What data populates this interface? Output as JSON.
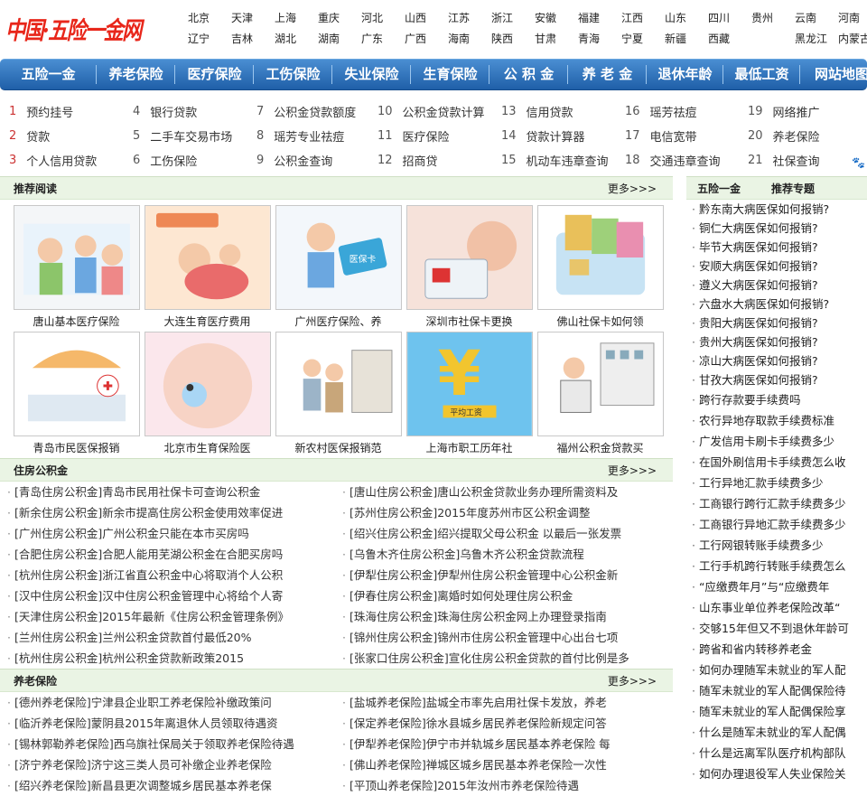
{
  "logo": {
    "text": "中国·五险一金网"
  },
  "cities": [
    "北京",
    "天津",
    "上海",
    "重庆",
    "河北",
    "山西",
    "江苏",
    "浙江",
    "安徽",
    "福建",
    "江西",
    "山东",
    "四川",
    "贵州",
    "云南",
    "河南",
    "辽宁",
    "吉林",
    "湖北",
    "湖南",
    "广东",
    "广西",
    "海南",
    "陕西",
    "甘肃",
    "青海",
    "宁夏",
    "新疆",
    "西藏",
    "",
    "黑龙江",
    "内蒙古"
  ],
  "nav": [
    "五险一金",
    "养老保险",
    "医疗保险",
    "工伤保险",
    "失业保险",
    "生育保险",
    "公 积 金",
    "养 老 金",
    "退休年龄",
    "最低工资",
    "网站地图"
  ],
  "hot": [
    {
      "n": "1",
      "t": "预约挂号"
    },
    {
      "n": "4",
      "t": "银行贷款"
    },
    {
      "n": "7",
      "t": "公积金贷款额度"
    },
    {
      "n": "10",
      "t": "公积金贷款计算"
    },
    {
      "n": "13",
      "t": "信用贷款"
    },
    {
      "n": "16",
      "t": "瑶芳祛痘"
    },
    {
      "n": "19",
      "t": "网络推广"
    },
    {
      "n": "2",
      "t": "贷款"
    },
    {
      "n": "5",
      "t": "二手车交易市场"
    },
    {
      "n": "8",
      "t": "瑶芳专业祛痘"
    },
    {
      "n": "11",
      "t": "医疗保险"
    },
    {
      "n": "14",
      "t": "贷款计算器"
    },
    {
      "n": "17",
      "t": "电信宽带"
    },
    {
      "n": "20",
      "t": "养老保险"
    },
    {
      "n": "3",
      "t": "个人信用贷款"
    },
    {
      "n": "6",
      "t": "工伤保险"
    },
    {
      "n": "9",
      "t": "公积金查询"
    },
    {
      "n": "12",
      "t": "招商贷"
    },
    {
      "n": "15",
      "t": "机动车违章查询"
    },
    {
      "n": "18",
      "t": "交通违章查询"
    },
    {
      "n": "21",
      "t": "社保查询"
    }
  ],
  "recommend": {
    "title": "推荐阅读",
    "more": "更多>>>",
    "items": [
      {
        "cap": "唐山基本医疗保险",
        "icon": "family-clinic-image"
      },
      {
        "cap": "大连生育医疗费用",
        "icon": "maternity-image"
      },
      {
        "cap": "广州医疗保险、养",
        "icon": "medical-card-image"
      },
      {
        "cap": "深圳市社保卡更换",
        "icon": "social-security-card-image"
      },
      {
        "cap": "佛山社保卡如何领",
        "icon": "cards-image"
      },
      {
        "cap": "青岛市民医保报销",
        "icon": "hospital-image"
      },
      {
        "cap": "北京市生育保险医",
        "icon": "baby-image"
      },
      {
        "cap": "新农村医保报销范",
        "icon": "village-clinic-image"
      },
      {
        "cap": "上海市职工历年社",
        "icon": "yuan-wage-image"
      },
      {
        "cap": "福州公积金贷款买",
        "icon": "housing-fund-image"
      }
    ]
  },
  "housing": {
    "title": "住房公积金",
    "more": "更多>>>",
    "left": [
      "[青岛住房公积金]青岛市民用社保卡可查询公积金",
      "[新余住房公积金]新余市提高住房公积金使用效率促进",
      "[广州住房公积金]广州公积金只能在本市买房吗",
      "[合肥住房公积金]合肥人能用芜湖公积金在合肥买房吗",
      "[杭州住房公积金]浙江省直公积金中心将取消个人公积",
      "[汉中住房公积金]汉中住房公积金管理中心将给个人寄",
      "[天津住房公积金]2015年最新《住房公积金管理条例》",
      "[兰州住房公积金]兰州公积金贷款首付最低20%",
      "[杭州住房公积金]杭州公积金贷款新政策2015"
    ],
    "right": [
      "[唐山住房公积金]唐山公积金贷款业务办理所需资料及",
      "[苏州住房公积金]2015年度苏州市区公积金调整",
      "[绍兴住房公积金]绍兴提取父母公积金 以最后一张发票",
      "[乌鲁木齐住房公积金]乌鲁木齐公积金贷款流程",
      "[伊犁住房公积金]伊犁州住房公积金管理中心公积金新",
      "[伊春住房公积金]离婚时如何处理住房公积金",
      "[珠海住房公积金]珠海住房公积金网上办理登录指南",
      "[锦州住房公积金]锦州市住房公积金管理中心出台七项",
      "[张家口住房公积金]宣化住房公积金贷款的首付比例是多"
    ]
  },
  "pension": {
    "title": "养老保险",
    "more": "更多>>>",
    "left": [
      "[德州养老保险]宁津县企业职工养老保险补缴政策问",
      "[临沂养老保险]蒙阴县2015年离退休人员领取待遇资",
      "[锡林郭勒养老保险]西乌旗社保局关于领取养老保险待遇",
      "[济宁养老保险]济宁这三类人员可补缴企业养老保险",
      "[绍兴养老保险]新昌县更次调整城乡居民基本养老保"
    ],
    "right": [
      "[盐城养老保险]盐城全市率先启用社保卡发放，养老",
      "[保定养老保险]徐水县城乡居民养老保险新规定问答",
      "[伊犁养老保险]伊宁市并轨城乡居民基本养老保险 每",
      "[佛山养老保险]禅城区城乡居民基本养老保险一次性",
      "[平顶山养老保险]2015年汝州市养老保险待遇"
    ]
  },
  "side": {
    "tab1": "五险一金",
    "tab2": "推荐专题",
    "items": [
      "黔东南大病医保如何报销?",
      "铜仁大病医保如何报销?",
      "毕节大病医保如何报销?",
      "安顺大病医保如何报销?",
      "遵义大病医保如何报销?",
      "六盘水大病医保如何报销?",
      "贵阳大病医保如何报销?",
      "贵州大病医保如何报销?",
      "凉山大病医保如何报销?",
      "甘孜大病医保如何报销?"
    ],
    "items2": [
      "跨行存款要手续费吗",
      "农行异地存取款手续费标准",
      "广发信用卡刷卡手续费多少",
      "在国外刷信用卡手续费怎么收",
      "工行异地汇款手续费多少",
      "工商银行跨行汇款手续费多少",
      "工商银行异地汇款手续费多少",
      "工行网银转账手续费多少",
      "工行手机跨行转账手续费怎么",
      "“应缴费年月”与“应缴费年",
      "山东事业单位养老保险改革“",
      "交够15年但又不到退休年龄可",
      "跨省和省内转移养老金",
      "如何办理随军未就业的军人配",
      "随军未就业的军人配偶保险待",
      "随军未就业的军人配偶保险享",
      "什么是随军未就业的军人配偶",
      "什么是远离军队医疗机构部队",
      "如何办理退役军人失业保险关"
    ]
  }
}
